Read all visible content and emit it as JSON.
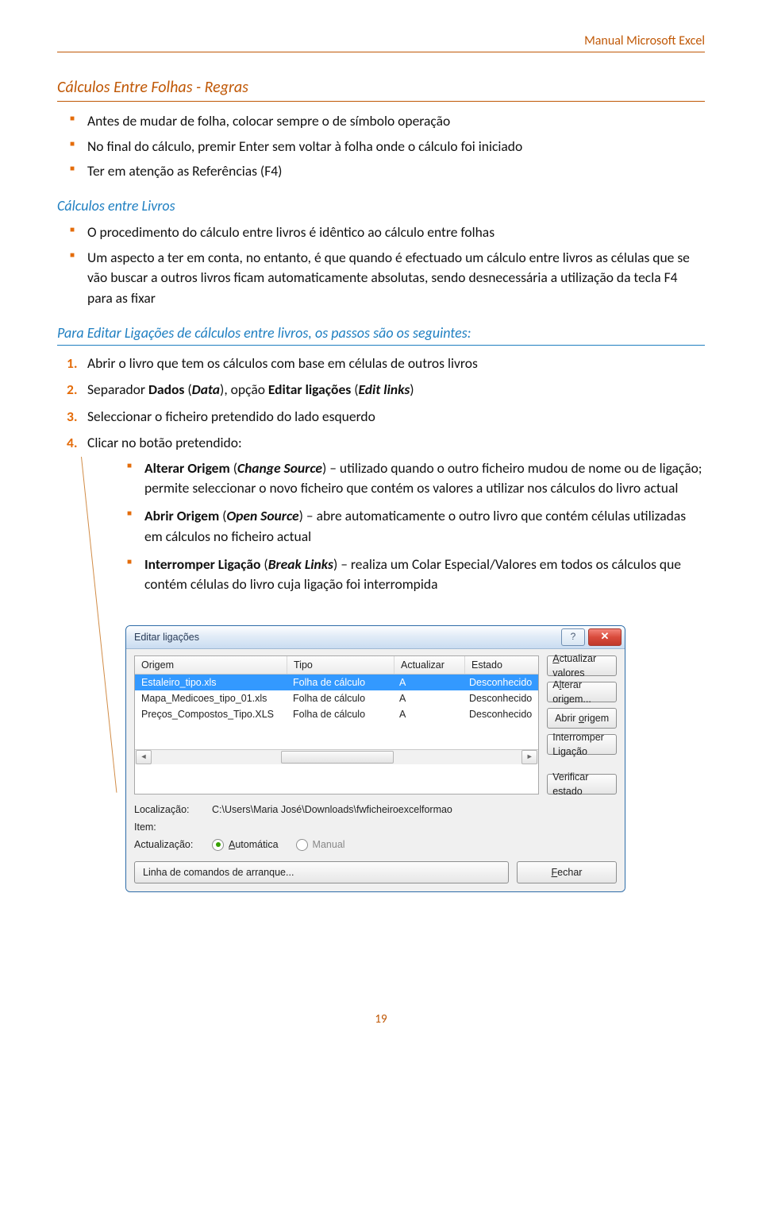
{
  "header": {
    "right": "Manual Microsoft Excel"
  },
  "h_regras": "Cálculos Entre Folhas - Regras",
  "regras_bullets": [
    "Antes de mudar de folha, colocar sempre o de símbolo operação",
    "No final do cálculo, premir Enter sem voltar à folha onde o cálculo foi iniciado",
    "Ter em atenção as Referências (F4)"
  ],
  "h_livros": "Cálculos entre Livros",
  "livros_bullets": [
    "O procedimento do cálculo entre livros é idêntico ao cálculo entre folhas",
    "Um aspecto a ter em conta, no entanto, é que quando é efectuado um cálculo entre livros as células que se vão buscar a outros livros ficam automaticamente absolutas, sendo desnecessária a utilização da tecla F4 para as fixar"
  ],
  "h_passos": "Para Editar Ligações de cálculos entre livros, os passos são os seguintes:",
  "steps": {
    "s1": "Abrir o livro que tem os cálculos com base em células de outros livros",
    "s2_pre": "Separador ",
    "s2_b1": "Dados",
    "s2_mid1": " (",
    "s2_i1": "Data",
    "s2_mid2": "), opção ",
    "s2_b2": "Editar ligações",
    "s2_mid3": " (",
    "s2_i2": "Edit links",
    "s2_end": ")",
    "s3": "Seleccionar o ficheiro pretendido do lado esquerdo",
    "s4": "Clicar no botão pretendido:"
  },
  "sub_bullets": {
    "b1": {
      "strong1": "Alterar Origem",
      "mid1": " (",
      "ital1": "Change Source",
      "rest": ") – utilizado quando o outro ficheiro mudou de nome ou de ligação; permite seleccionar o novo ficheiro que contém os valores a utilizar nos cálculos do livro actual"
    },
    "b2": {
      "strong1": "Abrir Origem",
      "mid1": " (",
      "ital1": "Open Source",
      "rest": ") – abre automaticamente o outro livro que contém células utilizadas em cálculos no ficheiro actual"
    },
    "b3": {
      "strong1": "Interromper Ligação",
      "mid1": " (",
      "ital1": "Break Links",
      "rest": ") – realiza um Colar Especial/Valores em todos os cálculos que contém células do livro cuja ligação foi interrompida"
    }
  },
  "dialog": {
    "title": "Editar ligações",
    "cols": {
      "c1": "Origem",
      "c2": "Tipo",
      "c3": "Actualizar",
      "c4": "Estado"
    },
    "rows": [
      {
        "c1": "Estaleiro_tipo.xls",
        "c2": "Folha de cálculo",
        "c3": "A",
        "c4": "Desconhecido",
        "selected": true
      },
      {
        "c1": "Mapa_Medicoes_tipo_01.xls",
        "c2": "Folha de cálculo",
        "c3": "A",
        "c4": "Desconhecido",
        "selected": false
      },
      {
        "c1": "Preços_Compostos_Tipo.XLS",
        "c2": "Folha de cálculo",
        "c3": "A",
        "c4": "Desconhecido",
        "selected": false
      }
    ],
    "buttons": {
      "b1": "Actualizar valores",
      "b2": "Alterar origem...",
      "b3": "Abrir origem",
      "b4": "Interromper Ligação",
      "b5": "Verificar estado"
    },
    "meta": {
      "loc_lbl": "Localização:",
      "loc_val": "C:\\Users\\Maria José\\Downloads\\fwficheiroexcelformao",
      "item_lbl": "Item:",
      "upd_lbl": "Actualização:",
      "opt_auto": "Automática",
      "opt_manual": "Manual"
    },
    "bottom": {
      "startup": "Linha de comandos de arranque...",
      "close": "Fechar"
    }
  },
  "pagenum": "19"
}
